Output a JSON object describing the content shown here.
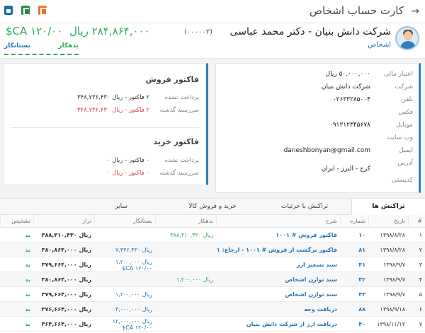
{
  "header": {
    "title": "کارت حساب اشخاص",
    "back_icon": "arrow-right-icon",
    "icons": [
      "print-icon",
      "excel-icon",
      "pdf-icon"
    ]
  },
  "person": {
    "name": "شرکت دانش بنیان - دکتر محمد عباسی",
    "code": "(۰۰۰۰۰۲)",
    "type": "اشخاص",
    "balance": "۲۸۴,۸۶۴,۰۰۰ ریال",
    "balance_secondary": "۱۲۰/۰۰ CA$",
    "creditor_label": "بستانکار",
    "debtor_label": "بدهکار"
  },
  "info": [
    {
      "label": "اعتبار مالی",
      "value": "۵۰,۰۰۰,۰۰۰ ریال"
    },
    {
      "label": "شرکت",
      "value": "شرکت دانش بنیان"
    },
    {
      "label": "تلفن",
      "value": "۰۲۶۳۳۲۸۵۰۰۴"
    },
    {
      "label": "فکس",
      "value": ""
    },
    {
      "label": "موبایل",
      "value": "۰۹۱۲۱۲۳۴۵۶۷۸"
    },
    {
      "label": "وب سایت",
      "value": ""
    },
    {
      "label": "ایمیل",
      "value": "daneshbonyan@gmail.com"
    },
    {
      "label": "آدرس",
      "value": "کرج - البرز - ایران"
    },
    {
      "label": "کدپستی",
      "value": ""
    }
  ],
  "invoices": {
    "sales": {
      "title": "فاکتور فروش",
      "unpaid_label": "پرداخت نشده",
      "unpaid_value": "۲ فاکتور - ریال ۳۴۸,۷۳۶,۴۳۰",
      "overdue_label": "سررسید گذشته",
      "overdue_value": "۲ فاکتور - ریال ۳۴۸,۷۳۶,۴۳۰"
    },
    "purchase": {
      "title": "فاکتور خرید",
      "unpaid_label": "پرداخت نشده",
      "unpaid_value": "۰ فاکتور - ریال ۰",
      "overdue_label": "سررسید گذشته",
      "overdue_value": "۰ فاکتور - ریال ۰"
    }
  },
  "tabs": [
    {
      "label": "تراکنش ها",
      "active": true
    },
    {
      "label": "تراکنش با جزئیات",
      "active": false
    },
    {
      "label": "خرید و فروش کالا",
      "active": false
    },
    {
      "label": "سایر",
      "active": false
    }
  ],
  "table": {
    "columns": [
      "#",
      "تاریخ",
      "شماره",
      "شرح",
      "بدهکار",
      "بستانکار",
      "تراز",
      "تشخیص"
    ],
    "rows": [
      {
        "idx": "۱",
        "date": "۱۳۹۸/۸/۲۸",
        "num": "۱۰",
        "desc": "فاکتور فروش # ۱۰۰۱",
        "debit": "ریال ۳۸۸,۳۱۰,۴۳۰",
        "credit": "",
        "balance": "ریال ۳۸۸,۳۱۰,۴۳۰",
        "status": "بد"
      },
      {
        "idx": "۲",
        "date": "۱۳۹۸/۸/۲۸",
        "num": "۸۱",
        "desc": "فاکتور برگشت از فروش # ۱۰۰۱ - ارجاع: ۱۰۰۱",
        "debit": "",
        "credit": "ریال ۷,۴۴۶,۴۳۰",
        "balance": "ریال ۳۸۰,۸۶۴,۰۰۰",
        "status": "بد"
      },
      {
        "idx": "۳",
        "date": "۱۳۹۸/۹/۷",
        "num": "۴۱",
        "desc": "سند تسعیر ارز",
        "debit": "",
        "credit": "ریال ۱,۲۰۰,۰۰۰",
        "credit2": "۱۲۰/۰۰ CA$",
        "balance": "ریال ۳۷۹,۶۶۴,۰۰۰",
        "status": "بد"
      },
      {
        "idx": "۴",
        "date": "۱۳۹۸/۹/۷",
        "num": "۴۲",
        "desc": "سند توازن اشخاص",
        "debit": "ریال ۱,۲۰۰,۰۰۰",
        "credit": "",
        "balance": "ریال ۳۸۰,۸۶۴,۰۰۰",
        "status": "بد"
      },
      {
        "idx": "۵",
        "date": "۱۳۹۸/۹/۷",
        "num": "۴۳",
        "desc": "سند توازن اشخاص",
        "debit": "",
        "credit": "ریال ۱,۲۰۰,۰۰۰",
        "balance": "ریال ۳۷۹,۶۶۴,۰۰۰",
        "status": "بد"
      },
      {
        "idx": "۶",
        "date": "۱۳۹۸/۹/۱۸",
        "num": "۸۸",
        "desc": "دریافت وجه",
        "debit": "",
        "credit": "ریال ۳,۰۰۰,۰۰۰",
        "balance": "ریال ۳۷۶,۶۶۴,۰۰۰",
        "status": "بد"
      },
      {
        "idx": "۷",
        "date": "۱۳۹۸/۱۱/۱۲",
        "num": "۴۰",
        "desc": "دریافت ارز از شرکت دانش بنیان",
        "debit": "",
        "credit": "ریال ۱۲,۰۰۰,۰۰۰",
        "credit2": "۱۲۰/۰۰ CA$",
        "balance": "ریال ۳۶۴,۶۶۴,۰۰۰",
        "status": "بد"
      }
    ]
  },
  "colors": {
    "accent": "#2f7ec1",
    "green": "#2bab57",
    "red": "#e0454a",
    "link": "#2574b5"
  }
}
